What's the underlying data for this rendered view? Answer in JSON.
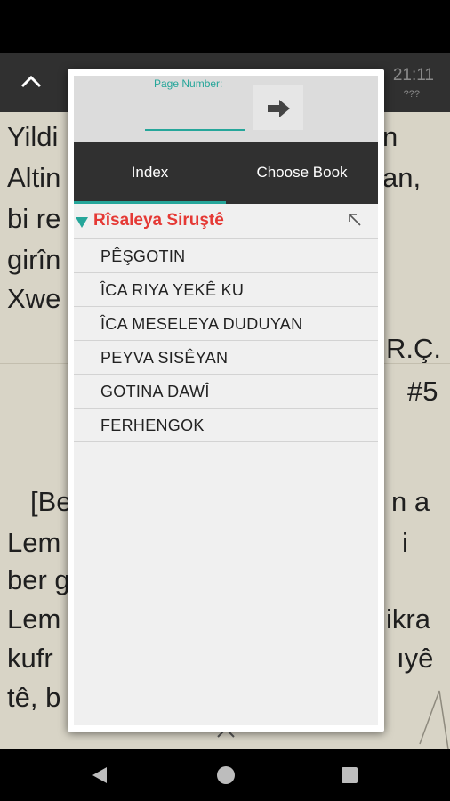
{
  "app_bar": {
    "time": "21:11",
    "sub": "???"
  },
  "reader": {
    "lines": [
      "Yildi",
      "n",
      "Altin",
      "an,",
      "bi re",
      "girîn",
      "Xwe",
      "R.Ç.",
      "#5",
      "[Be",
      "n a",
      "Lem",
      "i",
      "ber g",
      "Lem",
      "ikra",
      "kufr",
      "ıyê",
      "tê, b"
    ]
  },
  "dialog": {
    "page_number_label": "Page Number:",
    "page_number_value": "",
    "go_icon": "arrow-right-icon",
    "tabs": [
      "Index",
      "Choose Book"
    ],
    "active_tab": "Index",
    "toc": {
      "title": "Rîsaleya Siruştê",
      "items": [
        "PÊŞGOTIN",
        "ÎCA RIYA YEKÊ KU",
        "ÎCA MESELEYA DUDUYAN",
        "PEYVA SISÊYAN",
        "GOTINA DAWÎ",
        "FERHENGOK"
      ]
    }
  },
  "colors": {
    "accent": "#26a69a",
    "title_red": "#e53935",
    "dark": "#303030"
  }
}
